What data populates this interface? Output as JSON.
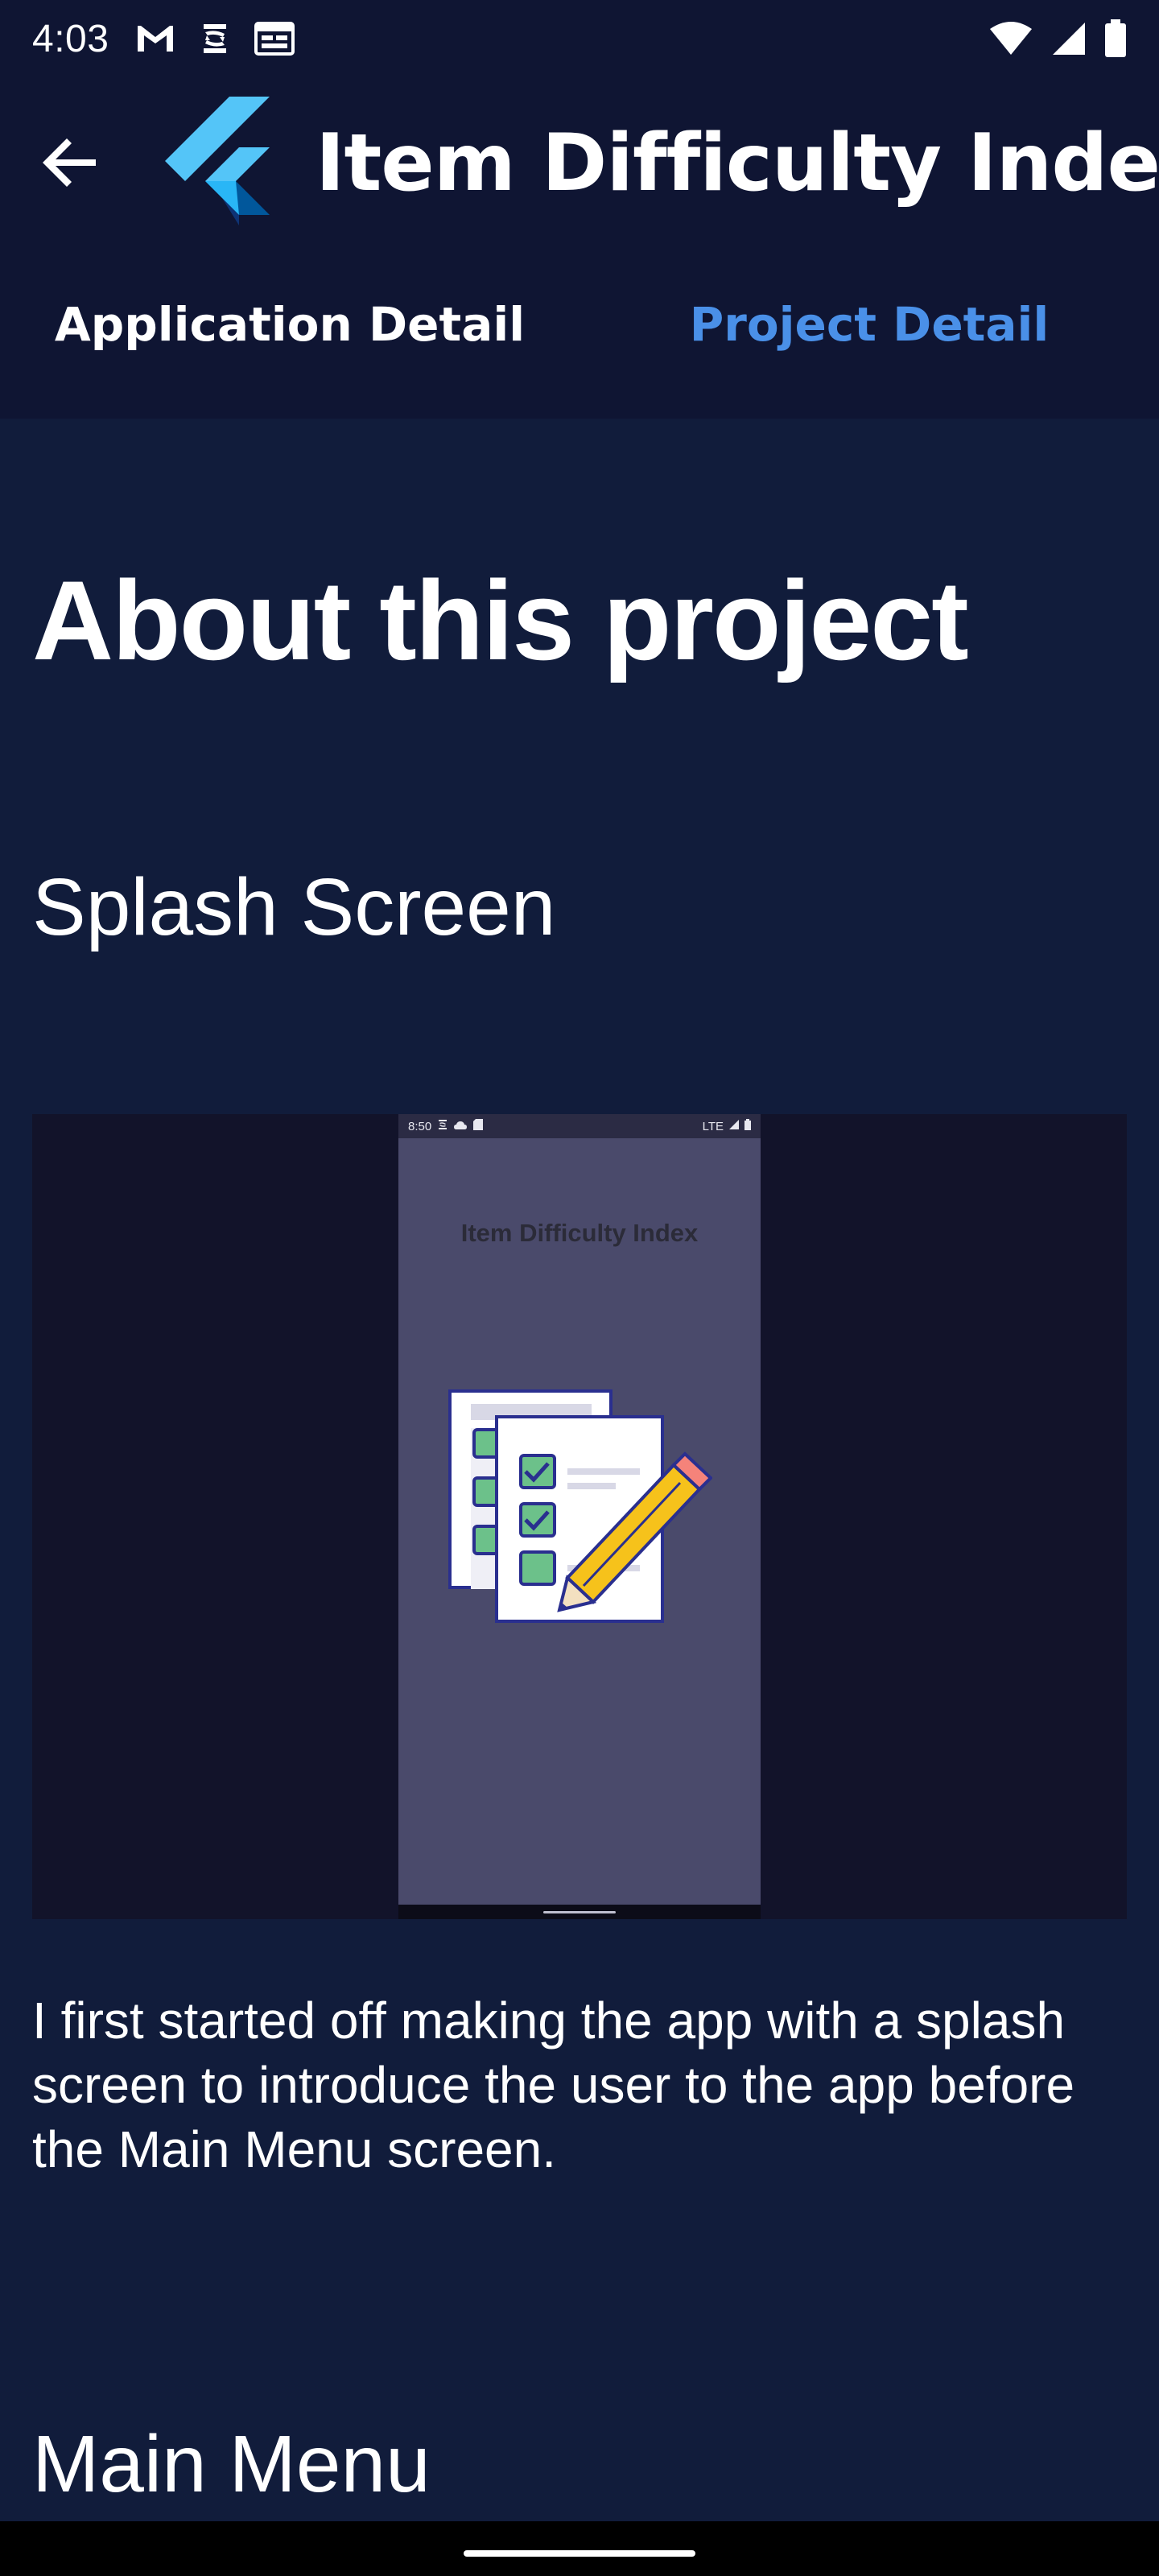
{
  "status_bar": {
    "time": "4:03",
    "left_icons": [
      "gmail-icon",
      "sync-icon",
      "calendar-icon"
    ],
    "right_icons": [
      "wifi-icon",
      "cellular-signal-icon",
      "battery-icon"
    ]
  },
  "app_bar": {
    "title": "Item Difficulty Index",
    "back_icon": "arrow-back-icon",
    "logo_icon": "flutter-logo-icon"
  },
  "tabs": [
    {
      "label": "Application Detail",
      "active": false
    },
    {
      "label": "Project Detail",
      "active": true
    }
  ],
  "content": {
    "heading": "About this project",
    "sections": [
      {
        "title": "Splash Screen",
        "screenshot": {
          "status_time": "8:50",
          "status_right": "LTE",
          "app_title": "Item Difficulty Index",
          "illustration": "checklist-with-pencil-icon"
        },
        "description": "I first started off making the app with a splash screen to introduce the user to the app before the Main Menu screen."
      },
      {
        "title": "Main Menu"
      }
    ]
  },
  "colors": {
    "background": "#111c3b",
    "app_bar": "#0f1533",
    "active_tab": "#4a90e8",
    "text": "#ffffff"
  }
}
